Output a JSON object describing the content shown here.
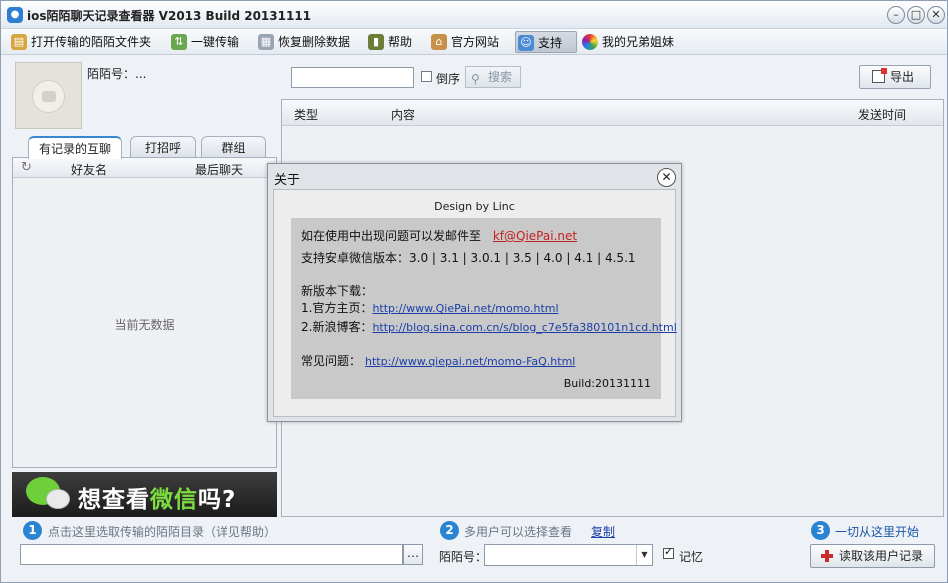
{
  "window": {
    "title": "ios陌陌聊天记录查看器 V2013 Build 20131111"
  },
  "toolbar": {
    "items": [
      {
        "label": "打开传输的陌陌文件夹",
        "icon": "folder-open-icon"
      },
      {
        "label": "一键传输",
        "icon": "transfer-icon"
      },
      {
        "label": "恢复删除数据",
        "icon": "restore-icon"
      },
      {
        "label": "帮助",
        "icon": "help-book-icon"
      },
      {
        "label": "官方网站",
        "icon": "home-icon"
      },
      {
        "label": "支持",
        "icon": "support-icon"
      },
      {
        "label": "我的兄弟姐妹",
        "icon": "siblings-icon"
      }
    ]
  },
  "profile": {
    "momo_id_label": "陌陌号：..."
  },
  "tabs": [
    "有记录的互聊",
    "打招呼",
    "群组"
  ],
  "friend_list": {
    "columns": [
      "好友名",
      "最后聊天"
    ],
    "empty_text": "当前无数据"
  },
  "banner": {
    "text_prefix": "想查看",
    "text_highlight": "微信",
    "text_suffix": "吗?"
  },
  "search": {
    "value": "",
    "reverse_label": "倒序",
    "search_label": "搜索",
    "export_label": "导出"
  },
  "messages": {
    "columns": [
      "类型",
      "内容",
      "发送时间"
    ]
  },
  "about": {
    "title": "关于",
    "design_by": "Design by Linc",
    "contact_text": "如在使用中出现问题可以发邮件至",
    "email": "kf@QiePai.net",
    "versions_text": "支持安卓微信版本：3.0 | 3.1 | 3.0.1 | 3.5 | 4.0 | 4.1 | 4.5.1",
    "download_heading": "新版本下载：",
    "official_label": "1.官方主页：",
    "official_url": "http://www.QiePai.net/momo.html",
    "sina_label": "2.新浪博客：",
    "sina_url": "http://blog.sina.com.cn/s/blog_c7e5fa380101n1cd.html",
    "faq_label": "常见问题：",
    "faq_url": "http://www.qiepai.net/momo-FaQ.html",
    "build": "Build:20131111",
    "close_glyph": "✕"
  },
  "bottom": {
    "step1_num": "1",
    "step1_text": "点击这里选取传输的陌陌目录（详见帮助）",
    "browse_label": "…",
    "step2_num": "2",
    "step2_text": "多用户可以选择查看",
    "copy_label": "复制",
    "momo_no_label": "陌陌号：",
    "remember_label": "记忆",
    "step3_num": "3",
    "step3_text": "一切从这里开始",
    "read_button": "读取该用户记录"
  },
  "colors": {
    "accent": "#2a84d2",
    "banner_highlight": "#7ddc3f",
    "link": "#1b3fa8",
    "email": "#c42121"
  }
}
